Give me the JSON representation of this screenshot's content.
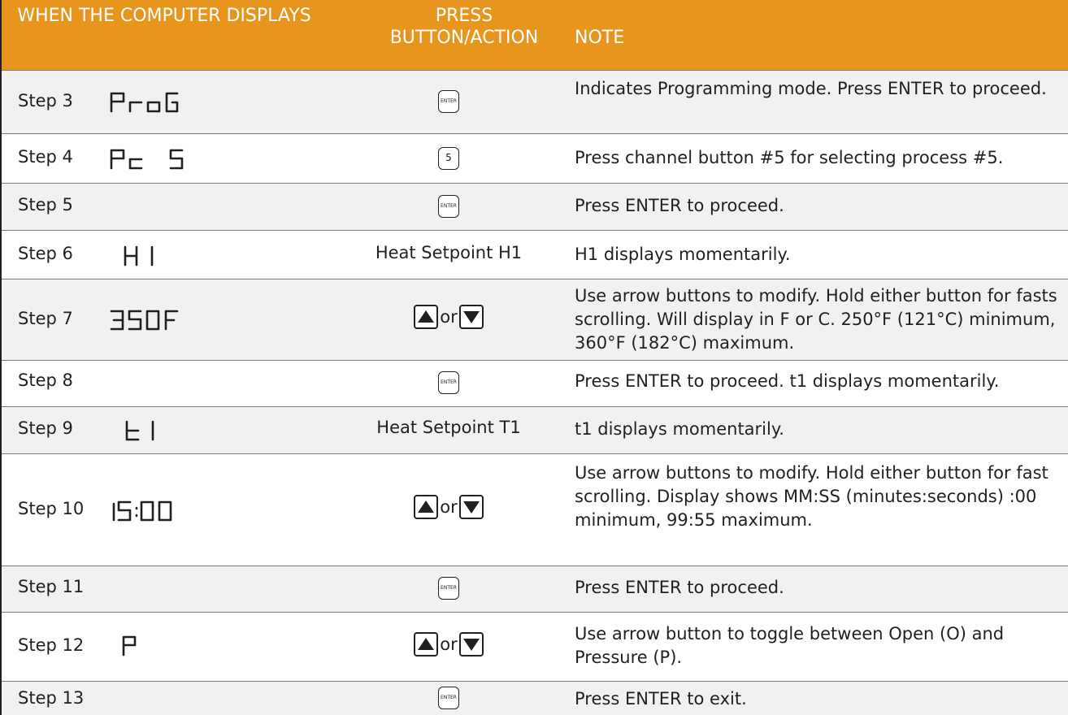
{
  "header": {
    "col1": "WHEN THE COMPUTER DISPLAYS",
    "col2": "PRESS BUTTON/ACTION",
    "col3": "NOTE"
  },
  "key_labels": {
    "enter": "ENTER",
    "or": "or"
  },
  "rows": [
    {
      "step": "Step 3",
      "display": "ProG",
      "action": "ENTER key",
      "note": "Indicates Programming mode. Press ENTER to proceed."
    },
    {
      "step": "Step 4",
      "display": "Pc 5",
      "action": "5",
      "note": "Press channel button #5 for selecting process #5."
    },
    {
      "step": "Step 5",
      "display": "",
      "action": "ENTER key",
      "note": "Press ENTER to proceed."
    },
    {
      "step": "Step 6",
      "display": "H 1",
      "action": "Heat Setpoint H1",
      "note": "H1 displays momentarily."
    },
    {
      "step": "Step 7",
      "display": "350F",
      "action": "up or down arrow",
      "note": "Use arrow buttons to modify. Hold either button for fasts scrolling. Will display in F or C. 250°F (121°C) minimum, 360°F (182°C) maximum."
    },
    {
      "step": "Step 8",
      "display": "",
      "action": "ENTER key",
      "note": "Press ENTER to proceed. t1 displays momentarily."
    },
    {
      "step": "Step 9",
      "display": "t 1",
      "action": "Heat Setpoint T1",
      "note": "t1 displays momentarily."
    },
    {
      "step": "Step 10",
      "display": "15:00",
      "action": "up or down arrow",
      "note": "Use arrow buttons to modify. Hold either button for fast scrolling. Display shows MM:SS (minutes:seconds) :00 minimum, 99:55 maximum."
    },
    {
      "step": "Step 11",
      "display": "",
      "action": "ENTER key",
      "note": "Press ENTER to proceed."
    },
    {
      "step": "Step 12",
      "display": "P",
      "action": "up or down arrow",
      "note": "Use arrow button to toggle between Open (O) and Pressure (P)."
    },
    {
      "step": "Step 13",
      "display": "",
      "action": "ENTER key",
      "note": "Press ENTER to exit."
    }
  ],
  "colors": {
    "header_bg": "#e8951e",
    "alt_row_bg": "#f1f1f2",
    "text": "#231f20"
  }
}
